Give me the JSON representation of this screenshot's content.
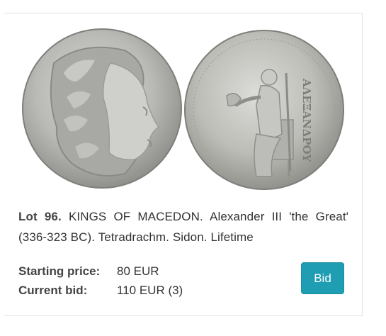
{
  "lot": {
    "number_label": "Lot 96.",
    "description": "KINGS OF MACEDON. Alexander III 'the Great' (336-323 BC). Tetradrachm. Sidon. Lifetime"
  },
  "coin_images": {
    "obverse_icon": "coin-obverse-heracles-icon",
    "reverse_icon": "coin-reverse-zeus-icon",
    "reverse_legend": "ΑΛΕΞΑΝΔΡΟΥ"
  },
  "prices": {
    "starting_label": "Starting price:",
    "starting_value": "80 EUR",
    "current_label": "Current bid:",
    "current_value": "110 EUR (3)"
  },
  "actions": {
    "bid_label": "Bid"
  },
  "colors": {
    "bid_button": "#1e9db3",
    "text": "#333333",
    "border": "#e3e3e3"
  }
}
